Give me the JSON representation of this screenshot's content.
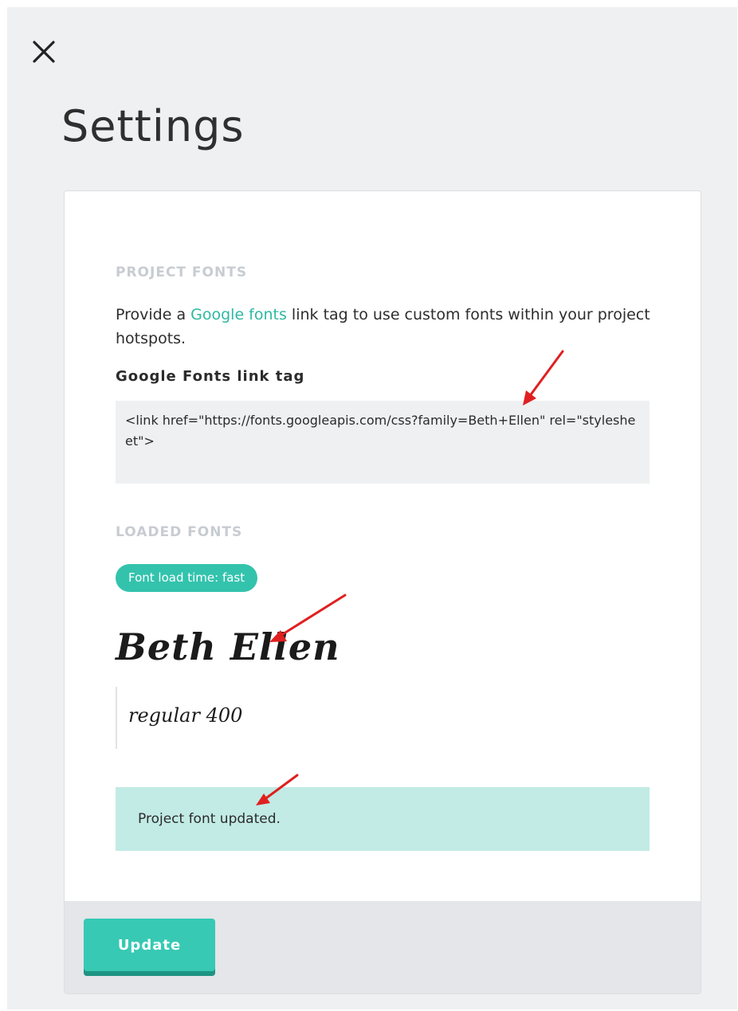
{
  "title": "Settings",
  "close_icon": "close-icon",
  "project_fonts": {
    "section_label": "PROJECT FONTS",
    "intro_before": "Provide a ",
    "intro_link": "Google fonts",
    "intro_after": " link tag to use custom fonts within your project hotspots.",
    "field_label": "Google Fonts link tag",
    "link_tag_value": "<link href=\"https://fonts.googleapis.com/css?family=Beth+Ellen\" rel=\"stylesheet\">"
  },
  "loaded_fonts": {
    "section_label": "LOADED FONTS",
    "load_time_badge": "Font load time: fast",
    "font_name": "Beth Ellen",
    "variant_sample": "regular 400"
  },
  "alert": {
    "message": "Project font updated."
  },
  "footer": {
    "update_label": "Update"
  },
  "colors": {
    "accent": "#33c3ad",
    "link": "#2fb8a3",
    "success_bg": "#c2ebe5",
    "page_bg": "#eff0f2",
    "annotation_arrow": "#e02020"
  }
}
